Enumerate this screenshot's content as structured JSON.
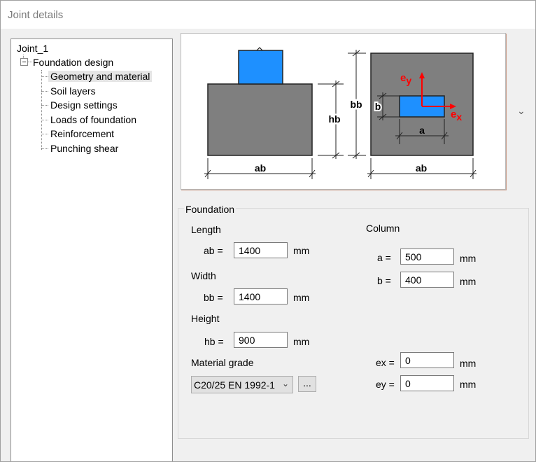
{
  "window": {
    "title": "Joint details"
  },
  "tree": {
    "root": "Joint_1",
    "parent": "Foundation design",
    "items": [
      {
        "label": "Geometry and material",
        "selected": true
      },
      {
        "label": "Soil layers"
      },
      {
        "label": "Design settings"
      },
      {
        "label": "Loads of foundation"
      },
      {
        "label": "Reinforcement"
      },
      {
        "label": "Punching shear"
      }
    ]
  },
  "diagram": {
    "labels": {
      "ab_left": "ab",
      "ab_right": "ab",
      "hb": "hb",
      "bb": "bb",
      "b": "b",
      "a": "a"
    },
    "colors": {
      "block": "#7f7f7f",
      "column": "#1e90ff",
      "axis": "#ff0000"
    }
  },
  "foundation": {
    "group_title": "Foundation",
    "length_heading": "Length",
    "ab_label": "ab =",
    "ab_value": "1400",
    "width_heading": "Width",
    "bb_label": "bb =",
    "bb_value": "1400",
    "height_heading": "Height",
    "hb_label": "hb =",
    "hb_value": "900",
    "material_heading": "Material grade",
    "material_value": "C20/25 EN 1992-1",
    "browse_label": "...",
    "unit": "mm"
  },
  "column": {
    "heading": "Column",
    "a_label": "a =",
    "a_value": "500",
    "b_label": "b =",
    "b_value": "400",
    "ex_label": "ex =",
    "ex_value": "0",
    "ey_label": "ey =",
    "ey_value": "0",
    "unit": "mm"
  }
}
